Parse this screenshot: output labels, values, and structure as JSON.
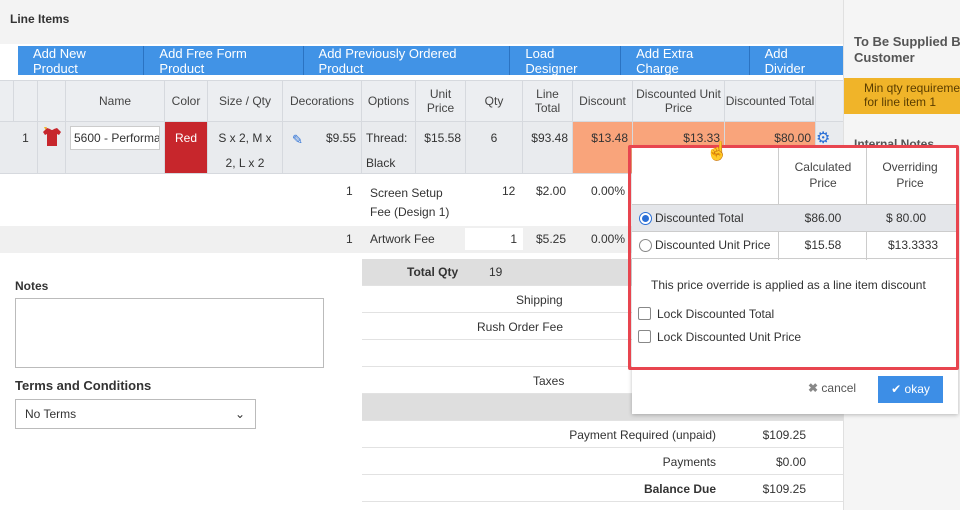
{
  "section_title": "Line Items",
  "toolbar": [
    "Add New Product",
    "Add Free Form Product",
    "Add Previously Ordered Product",
    "Load Designer",
    "Add Extra Charge",
    "Add Divider"
  ],
  "columns": {
    "name": "Name",
    "color": "Color",
    "size_qty": "Size / Qty",
    "decorations": "Decorations",
    "options": "Options",
    "unit_price": "Unit Price",
    "qty": "Qty",
    "line_total": "Line Total",
    "discount": "Discount",
    "disc_unit_price": "Discounted Unit Price",
    "disc_total": "Discounted Total"
  },
  "row1": {
    "num": "1",
    "name": "5600 - Performa",
    "color": "Red",
    "size_qty": "S x 2, M x 2, L x 2",
    "deco_price": "$9.55",
    "option": "Thread: Black",
    "unit_price": "$15.58",
    "qty": "6",
    "line_total": "$93.48",
    "discount": "$13.48",
    "disc_unit_price": "$13.33",
    "disc_total": "$80.00"
  },
  "fees": [
    {
      "num": "1",
      "name": "Screen Setup Fee (Design 1)",
      "qty": "12",
      "price": "$2.00",
      "discount": "0.00%"
    },
    {
      "num": "1",
      "name": "Artwork Fee",
      "qty": "1",
      "price": "$5.25",
      "discount": "0.00%"
    }
  ],
  "notes_label": "Notes",
  "terms_label": "Terms and Conditions",
  "terms_value": "No Terms",
  "totals": {
    "total_qty_label": "Total Qty",
    "total_qty": "19",
    "shipping": "Shipping",
    "rush": "Rush Order Fee",
    "taxes": "Taxes",
    "payment_required_label": "Payment Required (unpaid)",
    "payment_required": "$109.25",
    "payments_label": "Payments",
    "payments": "$0.00",
    "balance_due_label": "Balance Due",
    "balance_due": "$109.25"
  },
  "sidebar": {
    "title": "To Be Supplied By Customer",
    "warning": "Min qty requirement for line item 1",
    "internal_notes": "Internal Notes"
  },
  "popup": {
    "col_calculated": "Calculated Price",
    "col_overriding": "Overriding Price",
    "options": [
      {
        "label": "Discounted Total",
        "calculated": "$86.00",
        "overriding": "$  80.00",
        "selected": true
      },
      {
        "label": "Discounted Unit Price",
        "calculated": "$15.58",
        "overriding": "$13.3333",
        "selected": false
      }
    ],
    "note": "This price override is applied as a line item discount",
    "lock_total": "Lock Discounted Total",
    "lock_unit": "Lock Discounted Unit Price",
    "cancel": "cancel",
    "okay": "okay"
  },
  "colors": {
    "accent": "#3d8ee6",
    "highlight": "#f9a47b",
    "warning": "#f0b429",
    "outline": "#e8454f"
  }
}
